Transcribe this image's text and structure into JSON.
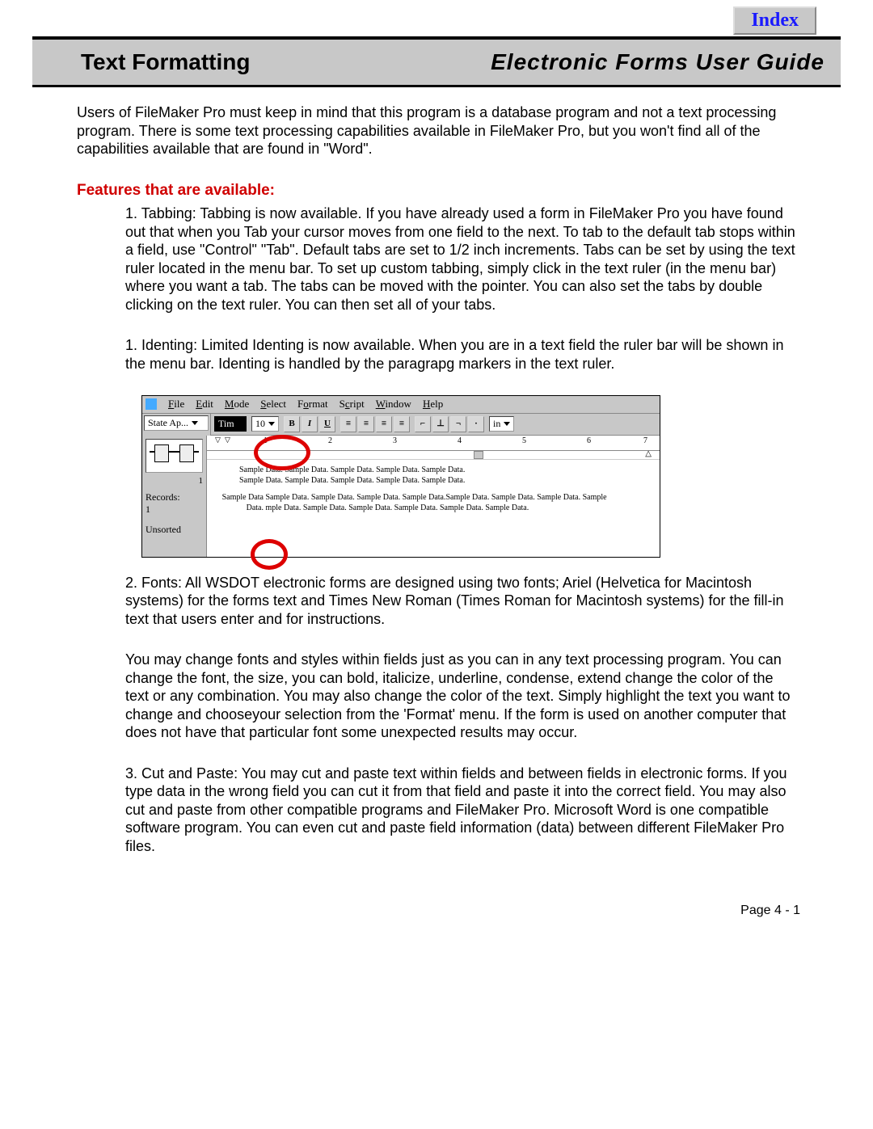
{
  "index_button": "Index",
  "header": {
    "left": "Text Formatting",
    "right": "Electronic Forms User Guide"
  },
  "intro": "Users of FileMaker Pro must keep in mind that this program is a database program and not a text processing program. There is some text processing capabilities available in FileMaker Pro, but you won't find all of the capabilities available that are found in \"Word\".",
  "features_heading": "Features that are available:",
  "items": {
    "tabbing": "1.  Tabbing:  Tabbing is now available. If you have already used a form in FileMaker Pro you have found out that when you Tab your cursor moves from one field to the next. To tab to the default tab stops within a field, use \"Control\" \"Tab\".  Default tabs are set to 1/2 inch increments.  Tabs can be set by using the text ruler located in the menu bar.  To set up custom tabbing, simply click in the text ruler (in the menu bar) where you want a tab.  The tabs can be moved with the pointer.  You can also set the tabs by double clicking on the text ruler.  You can then set all of your tabs.",
    "identing": "1.  Identing:  Limited Identing is now available. When you are in a text field the ruler bar will be shown in the menu bar.  Identing is handled by the paragrapg markers in the text ruler.",
    "fonts": "2.  Fonts:  All WSDOT electronic forms are designed using two fonts; Ariel (Helvetica for Macintosh systems) for the forms text and Times New Roman (Times Roman for Macintosh systems) for the fill-in text that users enter and for instructions.",
    "fontchange": "You may change fonts and styles within fields just as you can in any text processing program. You can change the font, the size, you can bold, italicize, underline, condense, extend change the color of the text or any combination. You may also change the color of the text.  Simply highlight the text you want to change and chooseyour selection from the 'Format' menu. If the form is used on another computer that does not have that particular font some unexpected results may occur.",
    "cutpaste": "3.  Cut and Paste:  You may cut and paste text within fields and between fields in electronic forms. If you type data in the wrong field you can cut it from that field and paste it into the correct field. You may also cut and paste from other compatible programs and FileMaker Pro. Microsoft Word is one compatible software program. You can even cut and paste field information (data) between different FileMaker Pro files."
  },
  "screenshot": {
    "menus": [
      "File",
      "Edit",
      "Mode",
      "Select",
      "Format",
      "Script",
      "Window",
      "Help"
    ],
    "layout_dd": "State Ap...",
    "font_dd": "Tim",
    "size_dd": "10",
    "unit_dd": "in",
    "left_labels": {
      "records": "Records:",
      "count": "1",
      "unsorted": "Unsorted"
    },
    "ruler_nums": [
      "1",
      "2",
      "3",
      "4",
      "5",
      "6",
      "7"
    ],
    "sample1": "Sample Data. Sample Data. Sample Data. Sample Data. Sample Data.",
    "sample2": "Sample Data. Sample Data. Sample Data. Sample Data. Sample Data.",
    "sample3a": "Sample Data",
    "sample3b": "Sample Data. Sample Data. Sample Data. Sample Data.Sample Data. Sample Data. Sample Data. Sample",
    "sample4a": "Data.",
    "sample4b": "mple Data. Sample Data. Sample Data. Sample Data. Sample Data. Sample Data."
  },
  "page_number": "Page  4 - 1"
}
